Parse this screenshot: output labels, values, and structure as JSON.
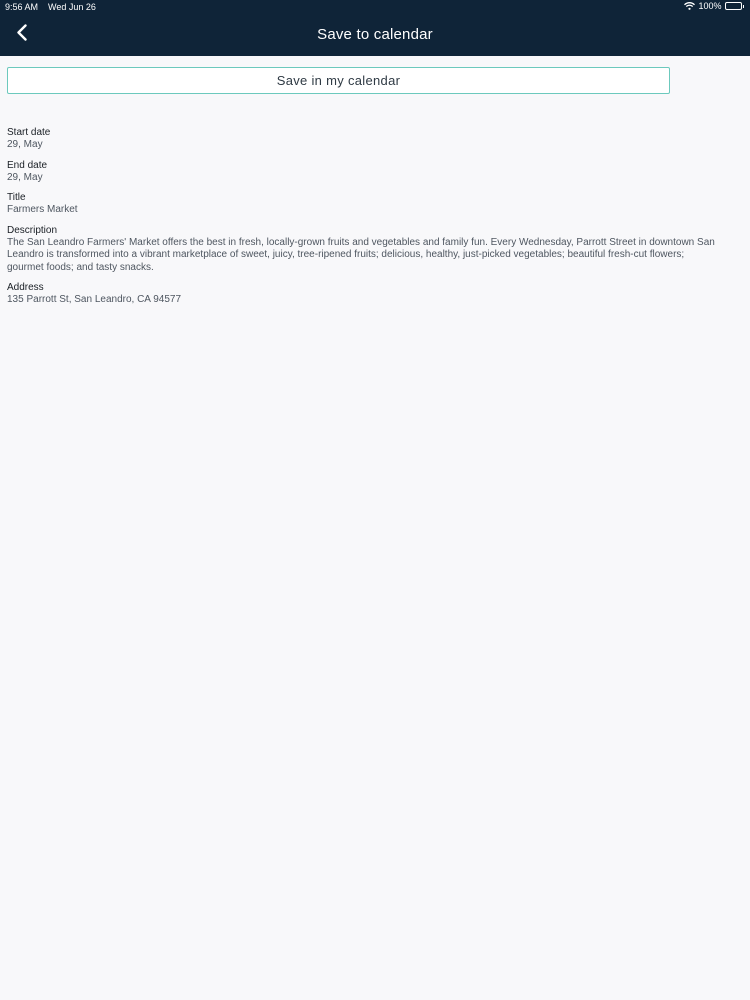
{
  "status_bar": {
    "time": "9:56 AM",
    "date": "Wed Jun 26",
    "battery": "100%",
    "wifi_icon": "wifi-icon",
    "battery_icon": "battery-icon"
  },
  "header": {
    "title": "Save to calendar",
    "back_icon": "chevron-left-icon",
    "background": "#0f2438"
  },
  "actions": {
    "save_label": "Save in my calendar",
    "border_color": "#6cc9bd"
  },
  "details": {
    "start_date": {
      "label": "Start date",
      "value": "29, May"
    },
    "end_date": {
      "label": "End date",
      "value": "29, May"
    },
    "title": {
      "label": "Title",
      "value": "Farmers Market"
    },
    "description": {
      "label": "Description",
      "value": "The San Leandro Farmers' Market offers the best in fresh, locally-grown fruits and vegetables and family fun. Every Wednesday, Parrott Street in downtown San Leandro is transformed into a vibrant marketplace of sweet, juicy, tree-ripened fruits; delicious, healthy, just-picked vegetables; beautiful fresh-cut flowers; gourmet foods; and tasty snacks."
    },
    "address": {
      "label": "Address",
      "value": "135 Parrott St, San Leandro, CA 94577"
    }
  }
}
